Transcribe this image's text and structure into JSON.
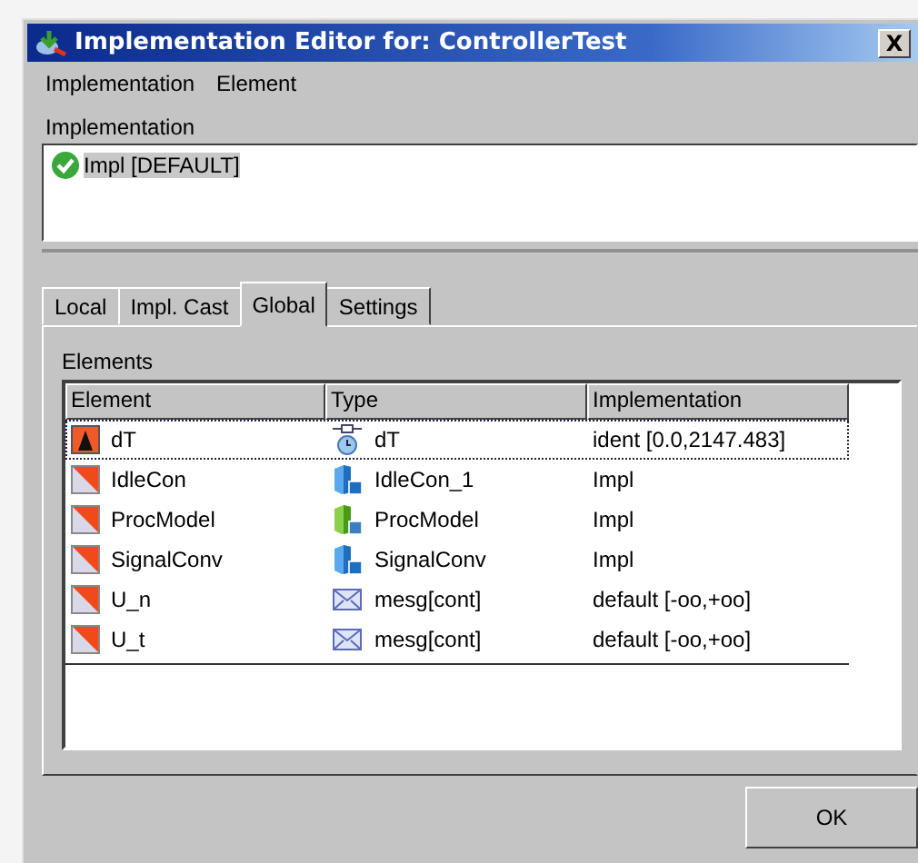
{
  "window": {
    "title": "Implementation Editor for: ControllerTest",
    "close": "X"
  },
  "menu": [
    "Implementation",
    "Element"
  ],
  "implementation": {
    "label": "Implementation",
    "items": [
      {
        "text": "Impl [DEFAULT]",
        "selected": true
      }
    ]
  },
  "tabs": [
    {
      "label": "Local",
      "selected": false
    },
    {
      "label": "Impl. Cast",
      "selected": false
    },
    {
      "label": "Global",
      "selected": true
    },
    {
      "label": "Settings",
      "selected": false
    }
  ],
  "elements": {
    "label": "Elements",
    "columns": [
      "Element",
      "Type",
      "Implementation"
    ],
    "rows": [
      {
        "element": {
          "text": "dT",
          "kind": "parameter"
        },
        "type": {
          "text": "dT",
          "kind": "clock"
        },
        "implementation": "ident [0.0,2147.483]",
        "selected": true
      },
      {
        "element": {
          "text": "IdleCon",
          "kind": "signal"
        },
        "type": {
          "text": "IdleCon_1",
          "kind": "blueblock"
        },
        "implementation": "Impl",
        "selected": false
      },
      {
        "element": {
          "text": "ProcModel",
          "kind": "signal"
        },
        "type": {
          "text": "ProcModel",
          "kind": "greenblock"
        },
        "implementation": "Impl",
        "selected": false
      },
      {
        "element": {
          "text": "SignalConv",
          "kind": "signal"
        },
        "type": {
          "text": "SignalConv",
          "kind": "blueblock"
        },
        "implementation": "Impl",
        "selected": false
      },
      {
        "element": {
          "text": "U_n",
          "kind": "signal"
        },
        "type": {
          "text": "mesg[cont]",
          "kind": "mail"
        },
        "implementation": "default [-oo,+oo]",
        "selected": false
      },
      {
        "element": {
          "text": "U_t",
          "kind": "signal"
        },
        "type": {
          "text": "mesg[cont]",
          "kind": "mail"
        },
        "implementation": "default [-oo,+oo]",
        "selected": false
      }
    ]
  },
  "ok_button": {
    "label": "OK"
  }
}
